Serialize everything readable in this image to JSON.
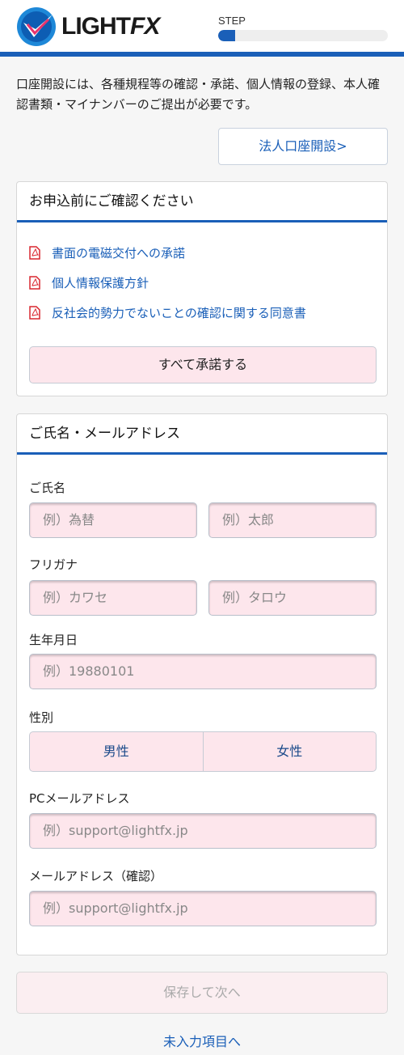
{
  "header": {
    "logo_text_light": "LIGHT",
    "logo_text_fx": "FX",
    "step_label": "STEP",
    "step_progress": 0.1,
    "brand_color": "#1a5fb8"
  },
  "intro_text": "口座開設には、各種規程等の確認・承諾、個人情報の登録、本人確認書類・マイナンバーのご提出が必要です。",
  "corporate_link": "法人口座開設>",
  "confirm_card": {
    "title": "お申込前にご確認ください",
    "documents": [
      {
        "label": "書面の電磁交付への承諾",
        "icon": "pdf-icon"
      },
      {
        "label": "個人情報保護方針",
        "icon": "pdf-icon"
      },
      {
        "label": "反社会的勢力でないことの確認に関する同意書",
        "icon": "pdf-icon"
      }
    ],
    "accept_all": "すべて承諾する"
  },
  "form_card": {
    "title": "ご氏名・メールアドレス",
    "name": {
      "label": "ご氏名",
      "last_placeholder": "例）為替",
      "first_placeholder": "例）太郎"
    },
    "kana": {
      "label": "フリガナ",
      "last_placeholder": "例）カワセ",
      "first_placeholder": "例）タロウ"
    },
    "birth": {
      "label": "生年月日",
      "placeholder": "例）19880101"
    },
    "gender": {
      "label": "性別",
      "options": [
        "男性",
        "女性"
      ]
    },
    "pc_email": {
      "label": "PCメールアドレス",
      "placeholder": "例）support@lightfx.jp"
    },
    "email_confirm": {
      "label": "メールアドレス（確認）",
      "placeholder": "例）support@lightfx.jp"
    }
  },
  "save_button": "保存して次へ",
  "missing_link": "未入力項目へ"
}
